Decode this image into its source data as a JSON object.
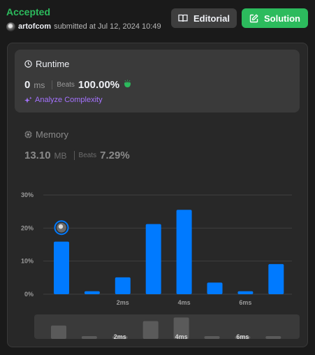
{
  "submission": {
    "status": "Accepted",
    "username": "artofcom",
    "submitted_text": "submitted at Jul 12, 2024 10:49"
  },
  "buttons": {
    "editorial_label": "Editorial",
    "solution_label": "Solution"
  },
  "runtime": {
    "title": "Runtime",
    "value": "0",
    "unit": "ms",
    "beats_label": "Beats",
    "beats_value": "100.00%",
    "analyze_label": "Analyze Complexity"
  },
  "memory": {
    "title": "Memory",
    "value": "13.10",
    "unit": "MB",
    "beats_label": "Beats",
    "beats_value": "7.29%"
  },
  "colors": {
    "accent_green": "#2cbb5d",
    "bar_blue": "#007aff",
    "analyze_purple": "#a573ff",
    "mini_bar_gray": "#5a5a5a"
  },
  "icons": {
    "editorial": "book-icon",
    "solution": "edit-icon",
    "runtime": "clock-icon",
    "memory": "chip-icon",
    "analyze": "sparkle-icon",
    "beats": "clap-icon"
  },
  "chart_data": {
    "type": "bar",
    "title": "",
    "xlabel": "",
    "ylabel": "",
    "ylim": [
      0,
      30
    ],
    "y_ticks": [
      "0%",
      "10%",
      "20%",
      "30%"
    ],
    "y_tick_values": [
      0,
      10,
      20,
      30
    ],
    "x_ticks": [
      "2ms",
      "4ms",
      "6ms"
    ],
    "x_tick_bar_index": [
      2,
      4,
      6
    ],
    "values": [
      15.9,
      0.9,
      5.1,
      21.2,
      25.5,
      3.5,
      0.9,
      9.1
    ],
    "highlighted_bar": 0,
    "grid": true,
    "navigator": {
      "values": [
        15.9,
        0.9,
        0.0,
        21.2,
        25.5,
        0.9,
        0.0,
        0.9
      ],
      "x_ticks": [
        "2ms",
        "4ms",
        "6ms"
      ]
    }
  }
}
